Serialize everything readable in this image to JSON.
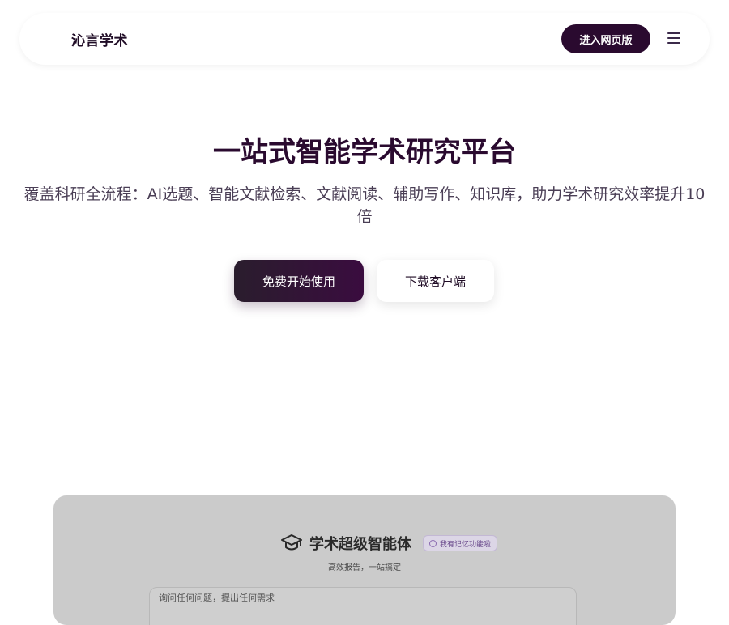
{
  "header": {
    "brand": "沁言学术",
    "enter_label": "进入网页版",
    "menu_icon": "hamburger-menu-icon"
  },
  "hero": {
    "title": "一站式智能学术研究平台",
    "subtitle": "覆盖科研全流程：AI选题、智能文献检索、文献阅读、辅助写作、知识库，助力学术研究效率提升10倍",
    "primary_cta": "免费开始使用",
    "secondary_cta": "下载客户端"
  },
  "preview": {
    "icon": "graduation-cap-icon",
    "title": "学术超级智能体",
    "badge": "我有记忆功能啦",
    "subtitle": "高效报告，一站搞定",
    "input_placeholder": "询问任何问题，提出任何需求"
  },
  "colors": {
    "brand": "#2a0a2f",
    "preview_bg": "#cbcbcb"
  }
}
